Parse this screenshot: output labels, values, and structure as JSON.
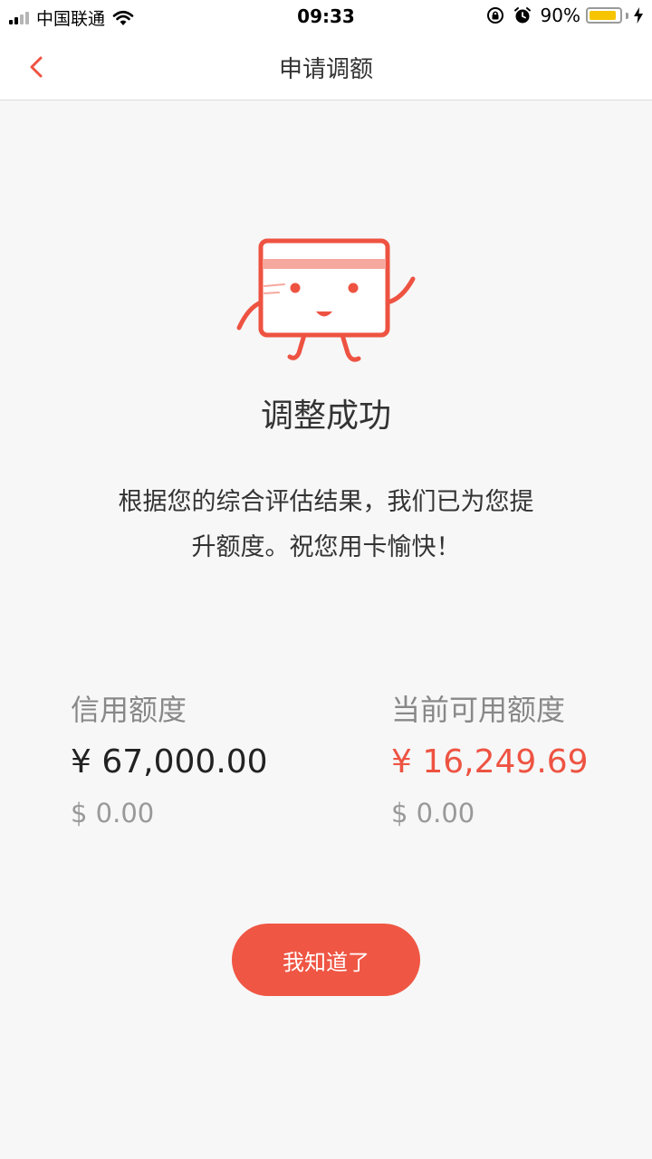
{
  "status_bar": {
    "carrier": "中国联通",
    "time": "09:33",
    "battery_percent": "90%",
    "battery_level": 0.9,
    "battery_color": "#f6c400"
  },
  "nav": {
    "back_icon": "chevron-left-icon",
    "title": "申请调额"
  },
  "result": {
    "icon": "credit-card-mascot-icon",
    "title": "调整成功",
    "description_line1": "根据您的综合评估结果，我们已为您提",
    "description_line2": "升额度。祝您用卡愉快！"
  },
  "limits": {
    "credit_limit": {
      "label": "信用额度",
      "cny": "¥ 67,000.00",
      "usd": "$ 0.00"
    },
    "available_limit": {
      "label": "当前可用额度",
      "cny": "¥ 16,249.69",
      "usd": "$ 0.00"
    }
  },
  "confirm_button": {
    "label": "我知道了"
  },
  "colors": {
    "accent": "#ef5644",
    "available_amount": "#ee5342",
    "background": "#f7f7f7"
  }
}
